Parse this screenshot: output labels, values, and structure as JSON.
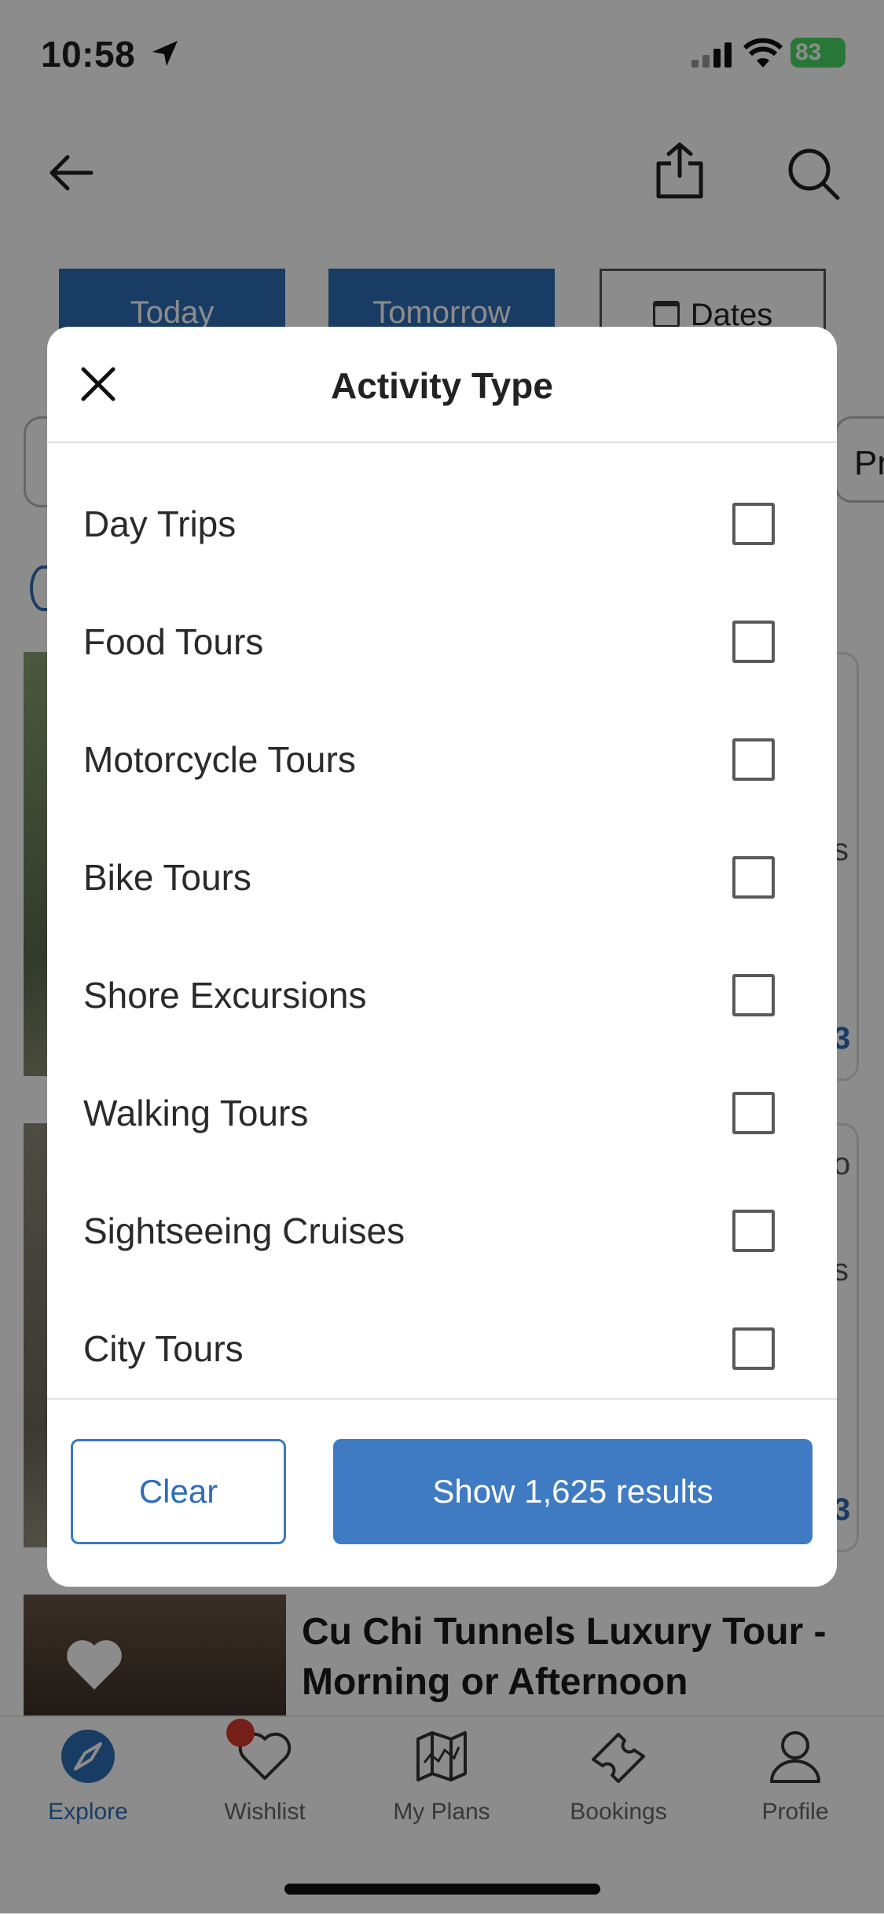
{
  "status_bar": {
    "time": "10:58",
    "battery": "83"
  },
  "background": {
    "date_chips": {
      "today": "Today",
      "tomorrow": "Tomorrow",
      "dates": "Dates"
    },
    "filter_partial": "Pr",
    "card_title": "Cu Chi Tunnels Luxury Tour - Morning or Afternoon",
    "edge_glyphs": {
      "a": "s",
      "b": "3",
      "c": "o",
      "d": "s",
      "e": "3"
    }
  },
  "tabbar": {
    "items": [
      {
        "label": "Explore",
        "icon": "compass-icon"
      },
      {
        "label": "Wishlist",
        "icon": "heart-icon"
      },
      {
        "label": "My Plans",
        "icon": "map-icon"
      },
      {
        "label": "Bookings",
        "icon": "ticket-icon"
      },
      {
        "label": "Profile",
        "icon": "person-icon"
      }
    ],
    "active": "Explore"
  },
  "modal": {
    "title": "Activity Type",
    "options": [
      {
        "label": "Day Trips",
        "checked": false
      },
      {
        "label": "Food Tours",
        "checked": false
      },
      {
        "label": "Motorcycle Tours",
        "checked": false
      },
      {
        "label": "Bike Tours",
        "checked": false
      },
      {
        "label": "Shore Excursions",
        "checked": false
      },
      {
        "label": "Walking Tours",
        "checked": false
      },
      {
        "label": "Sightseeing Cruises",
        "checked": false
      },
      {
        "label": "City Tours",
        "checked": false
      }
    ],
    "clear_label": "Clear",
    "show_label": "Show 1,625 results"
  },
  "colors": {
    "accent": "#3f7bc2",
    "badge": "#d33a2c",
    "battery": "#4cd964"
  }
}
